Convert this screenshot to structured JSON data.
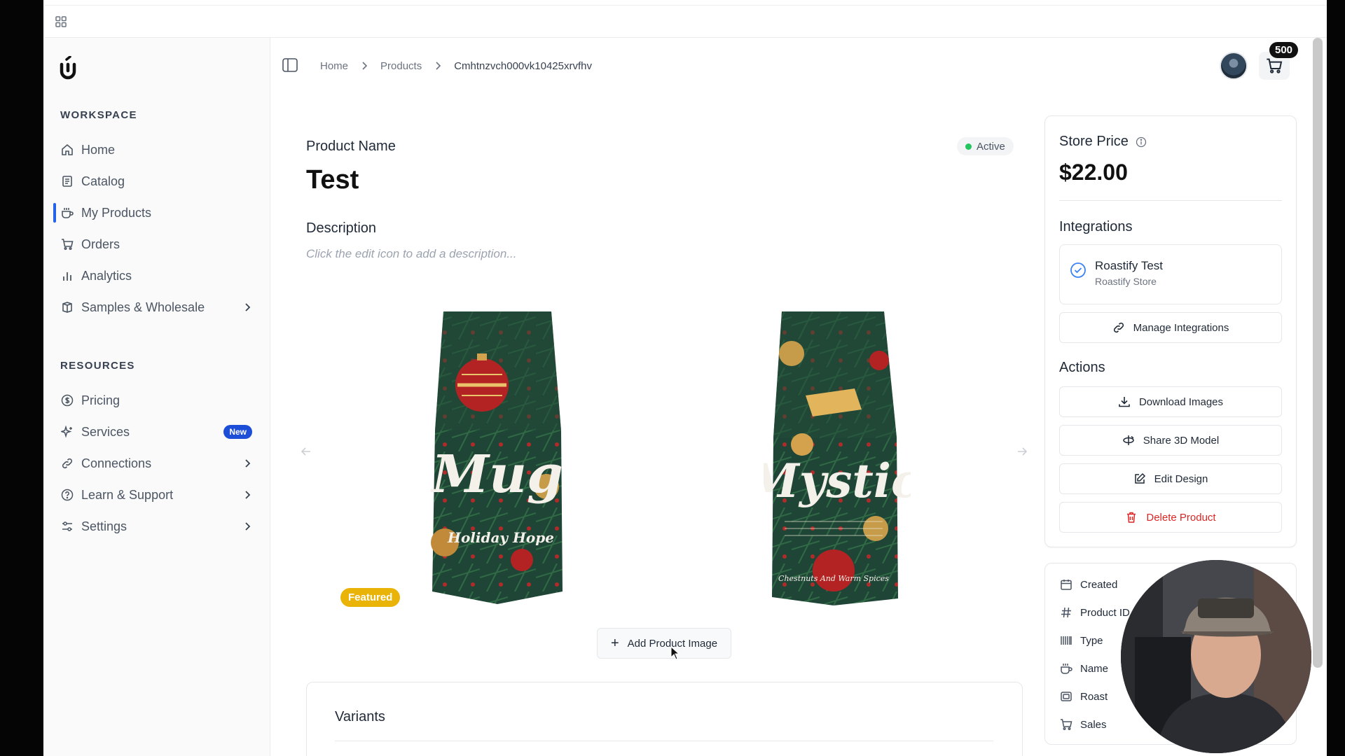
{
  "sidebar": {
    "workspace_title": "WORKSPACE",
    "workspace_items": [
      {
        "label": "Home",
        "icon": "home-icon"
      },
      {
        "label": "Catalog",
        "icon": "book-icon"
      },
      {
        "label": "My Products",
        "icon": "coffee-cup-icon",
        "active": true
      },
      {
        "label": "Orders",
        "icon": "cart-icon"
      },
      {
        "label": "Analytics",
        "icon": "bar-chart-icon"
      },
      {
        "label": "Samples & Wholesale",
        "icon": "package-icon",
        "has_chevron": true
      }
    ],
    "resources_title": "RESOURCES",
    "resources_items": [
      {
        "label": "Pricing",
        "icon": "dollar-circle-icon"
      },
      {
        "label": "Services",
        "icon": "sparkles-icon",
        "badge": "New"
      },
      {
        "label": "Connections",
        "icon": "link-icon",
        "has_chevron": true
      },
      {
        "label": "Learn & Support",
        "icon": "help-circle-icon",
        "has_chevron": true
      },
      {
        "label": "Settings",
        "icon": "sliders-icon",
        "has_chevron": true
      }
    ]
  },
  "header": {
    "breadcrumb": [
      "Home",
      "Products",
      "Cmhtnzvch000vk10425xrvfhv"
    ],
    "cart_count": "500"
  },
  "product": {
    "name_label": "Product Name",
    "name": "Test",
    "status": "Active",
    "description_label": "Description",
    "description_placeholder": "Click the edit icon to add a description...",
    "featured_badge": "Featured",
    "add_image_label": "Add Product Image",
    "images": [
      {
        "brand_text": "Mug",
        "sub_text": "Holiday Hope"
      },
      {
        "brand_text": "Mystic",
        "sub_text": "Chestnuts And Warm Spices"
      }
    ]
  },
  "variants": {
    "title": "Variants"
  },
  "pricing": {
    "store_price_label": "Store Price",
    "store_price": "$22.00"
  },
  "integrations": {
    "title": "Integrations",
    "items": [
      {
        "name": "Roastify Test",
        "subtitle": "Roastify Store"
      }
    ],
    "manage_label": "Manage Integrations"
  },
  "actions": {
    "title": "Actions",
    "download_label": "Download Images",
    "share_label": "Share 3D Model",
    "edit_label": "Edit Design",
    "delete_label": "Delete Product"
  },
  "details": {
    "rows": [
      {
        "label": "Created",
        "icon": "calendar-icon"
      },
      {
        "label": "Product ID",
        "icon": "hash-icon"
      },
      {
        "label": "Type",
        "icon": "barcode-icon"
      },
      {
        "label": "Name",
        "icon": "coffee-cup-icon"
      },
      {
        "label": "Roast",
        "icon": "roast-icon"
      },
      {
        "label": "Sales",
        "icon": "cart-icon"
      }
    ]
  },
  "colors": {
    "accent": "#2563eb",
    "status_active": "#22c55e",
    "featured": "#eab308",
    "danger": "#dc2626",
    "new_badge": "#1d4ed8"
  }
}
